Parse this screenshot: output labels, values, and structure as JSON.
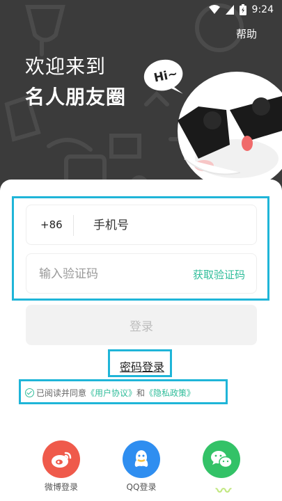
{
  "status": {
    "time": "9:24"
  },
  "header": {
    "help": "帮助",
    "welcome": "欢迎来到",
    "app_name": "名人朋友圈",
    "bubble": "Hi~"
  },
  "form": {
    "country_code": "+86",
    "phone_placeholder": "手机号",
    "code_placeholder": "输入验证码",
    "get_code": "获取验证码",
    "login": "登录",
    "password_login": "密码登录"
  },
  "agreement": {
    "prefix": "已阅读并同意",
    "user_agreement": "《用户协议》",
    "and": "和",
    "privacy": "《隐私政策》"
  },
  "social": [
    {
      "label": "微博登录"
    },
    {
      "label": "QQ登录"
    },
    {
      "label": ""
    }
  ],
  "colors": {
    "accent": "#2fbd9a",
    "highlight": "#1fb5d8",
    "weibo": "#ef5a4b",
    "qq": "#2f8ef0",
    "wechat": "#33c267"
  }
}
